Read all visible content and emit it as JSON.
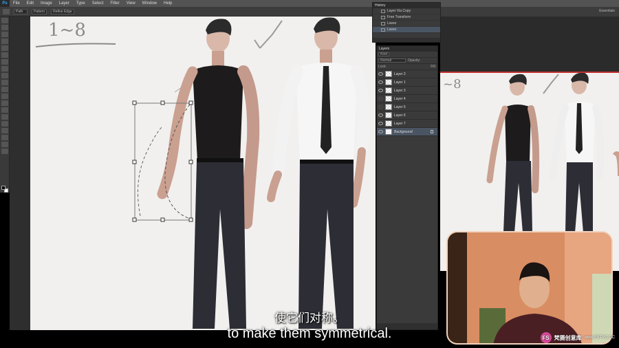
{
  "app": {
    "logo": "Ps"
  },
  "menu": [
    "File",
    "Edit",
    "Image",
    "Layer",
    "Type",
    "Select",
    "Filter",
    "View",
    "Window",
    "Help"
  ],
  "options_bar": {
    "fields": [
      "Path",
      "Pattern",
      "Refine Edge"
    ],
    "workspace": "Essentials"
  },
  "history": {
    "title": "History",
    "items": [
      {
        "label": "Layer Via Copy",
        "icon": "layer-state-icon"
      },
      {
        "label": "Free Transform",
        "icon": "transform-state-icon"
      },
      {
        "label": "Lasso",
        "icon": "lasso-state-icon"
      },
      {
        "label": "Lasso",
        "icon": "lasso-state-icon",
        "selected": true
      }
    ]
  },
  "layers": {
    "title": "Layers",
    "kind_label": "Kind",
    "blend_mode": "Normal",
    "opacity_label": "Opacity:",
    "lock_label": "Lock:",
    "fill_label": "Fill:",
    "items": [
      {
        "name": "Layer 2",
        "visible": true
      },
      {
        "name": "Layer 1",
        "visible": true
      },
      {
        "name": "Layer 3",
        "visible": true
      },
      {
        "name": "Layer 4",
        "visible": false
      },
      {
        "name": "Layer 5",
        "visible": false
      },
      {
        "name": "Layer 6",
        "visible": true
      },
      {
        "name": "Layer 7",
        "visible": true
      },
      {
        "name": "Background",
        "visible": true,
        "locked": true
      }
    ]
  },
  "canvas": {
    "sketch_note": "1~8"
  },
  "second_window": {
    "sketch_note": "~8"
  },
  "subtitles": {
    "cn": "使它们对称。",
    "en": "to make them symmetrical."
  },
  "watermark": {
    "logo": "FS",
    "name": "梵摄创意库",
    "url": "www.FSTVC.CC"
  },
  "colors": {
    "ui_dark": "#3a3a3a",
    "selection": "#4a5563",
    "canvas": "#f1f0ee",
    "webcam_wall": "#d98d62"
  }
}
